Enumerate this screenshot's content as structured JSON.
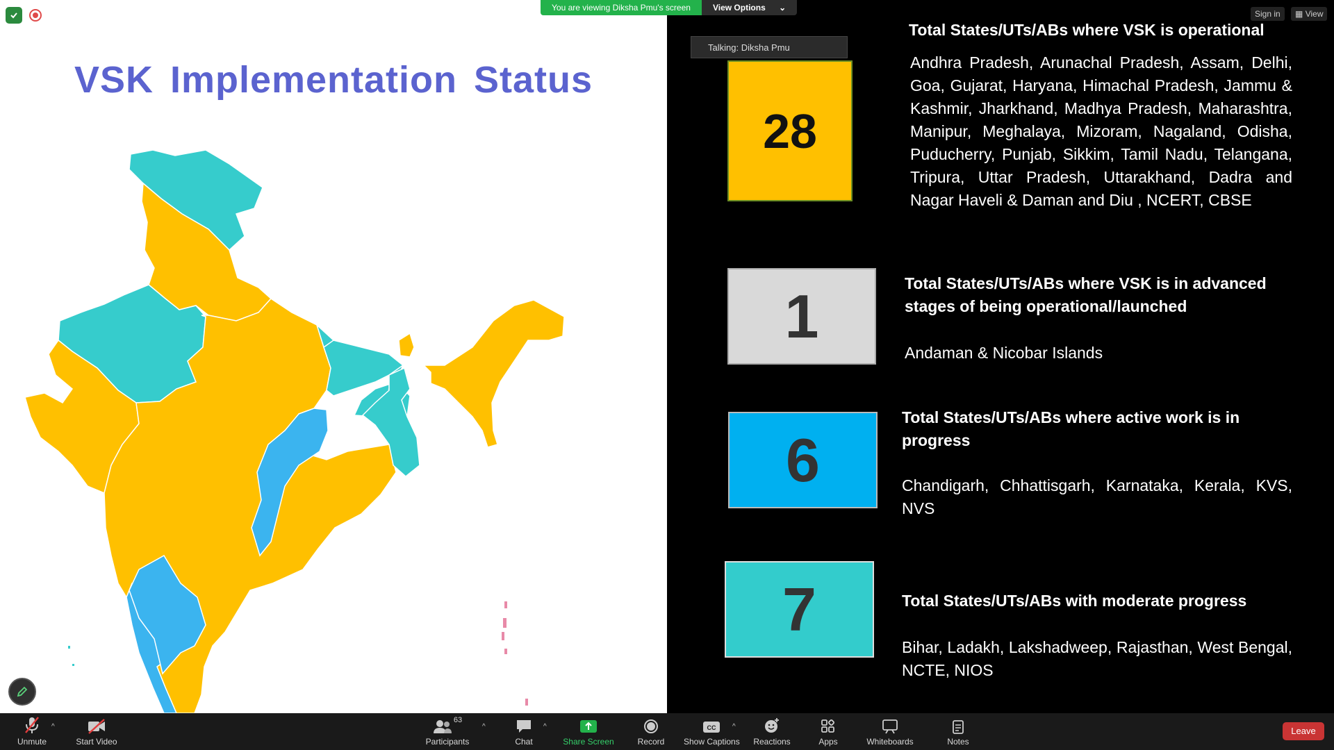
{
  "share_banner": {
    "viewing_text": "You are viewing Diksha Pmu's screen",
    "view_options_label": "View Options"
  },
  "talking_indicator": "Talking: Diksha Pmu",
  "top_right": {
    "sign_in": "Sign in",
    "view": "View"
  },
  "slide": {
    "title": "VSK Implementation Status",
    "categories": [
      {
        "count": "28",
        "color": "#FFC000",
        "heading": "Total States/UTs/ABs where VSK is operational",
        "list": "Andhra Pradesh, Arunachal Pradesh, Assam, Delhi, Goa, Gujarat, Haryana, Himachal Pradesh, Jammu & Kashmir, Jharkhand, Madhya Pradesh, Maharashtra, Manipur, Meghalaya, Mizoram, Nagaland, Odisha, Puducherry, Punjab, Sikkim, Tamil Nadu, Telangana, Tripura, Uttar Pradesh, Uttarakhand, Dadra and Nagar Haveli & Daman and Diu , NCERT, CBSE"
      },
      {
        "count": "1",
        "color": "#D9D9D9",
        "heading": "Total States/UTs/ABs where VSK is in advanced stages of being operational/launched",
        "list": "Andaman & Nicobar Islands"
      },
      {
        "count": "6",
        "color": "#00B0F0",
        "heading": "Total States/UTs/ABs where active work is in progress",
        "list": "Chandigarh, Chhattisgarh, Karnataka, Kerala, KVS, NVS"
      },
      {
        "count": "7",
        "color": "#33CCCC",
        "heading": "Total States/UTs/ABs with moderate progress",
        "list": "Bihar, Ladakh, Lakshadweep, Rajasthan, West Bengal, NCTE, NIOS"
      }
    ],
    "map_colors": {
      "operational": "#FFC000",
      "active": "#3BB4EF",
      "moderate": "#36CCCC",
      "advanced": "#E88AA8"
    }
  },
  "toolbar": {
    "unmute": "Unmute",
    "start_video": "Start Video",
    "participants": "Participants",
    "participant_count": "63",
    "chat": "Chat",
    "share_screen": "Share Screen",
    "record": "Record",
    "show_captions": "Show Captions",
    "reactions": "Reactions",
    "apps": "Apps",
    "whiteboards": "Whiteboards",
    "notes": "Notes",
    "leave": "Leave"
  }
}
